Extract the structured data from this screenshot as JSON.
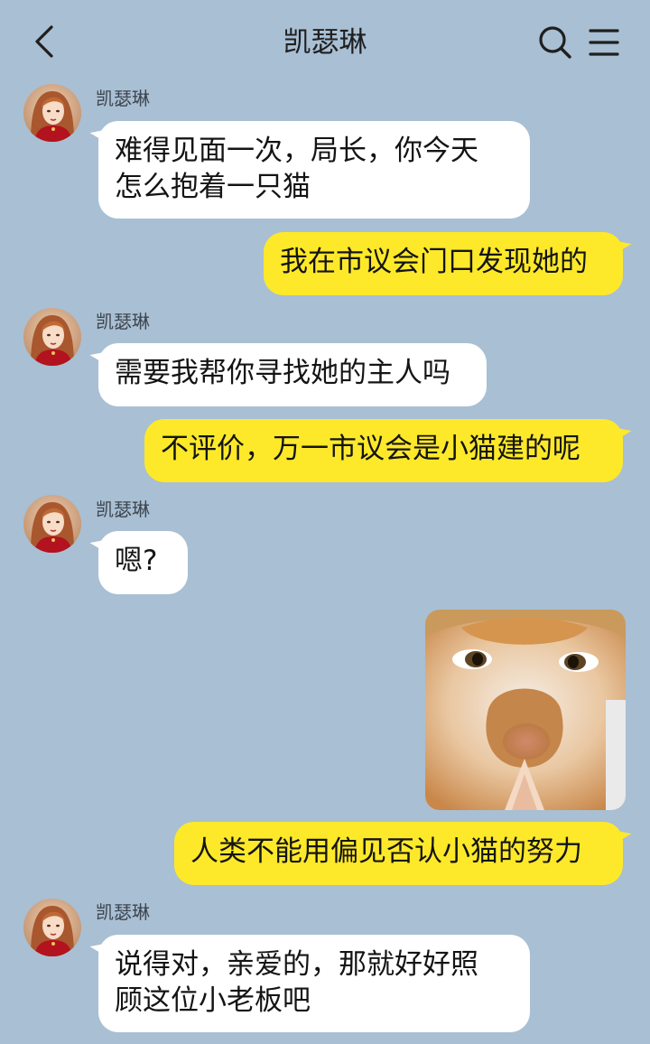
{
  "header": {
    "title": "凯瑟琳"
  },
  "colors": {
    "background": "#a9bfd3",
    "incoming_bubble": "#ffffff",
    "outgoing_bubble": "#fde92a"
  },
  "messages": [
    {
      "direction": "incoming",
      "sender": "凯瑟琳",
      "lines": [
        "难得见面一次，局长，你今天",
        "怎么抱着一只猫"
      ]
    },
    {
      "direction": "outgoing",
      "text": "我在市议会门口发现她的"
    },
    {
      "direction": "incoming",
      "sender": "凯瑟琳",
      "text": "需要我帮你寻找她的主人吗"
    },
    {
      "direction": "outgoing",
      "text": "不评价，万一市议会是小猫建的呢"
    },
    {
      "direction": "incoming",
      "sender": "凯瑟琳",
      "text": "嗯?"
    },
    {
      "direction": "outgoing",
      "type": "image",
      "image_subject": "orange-white-cat-photo"
    },
    {
      "direction": "outgoing",
      "text": "人类不能用偏见否认小猫的努力"
    },
    {
      "direction": "incoming",
      "sender": "凯瑟琳",
      "lines": [
        "说得对，亲爱的，那就好好照",
        "顾这位小老板吧"
      ]
    }
  ]
}
